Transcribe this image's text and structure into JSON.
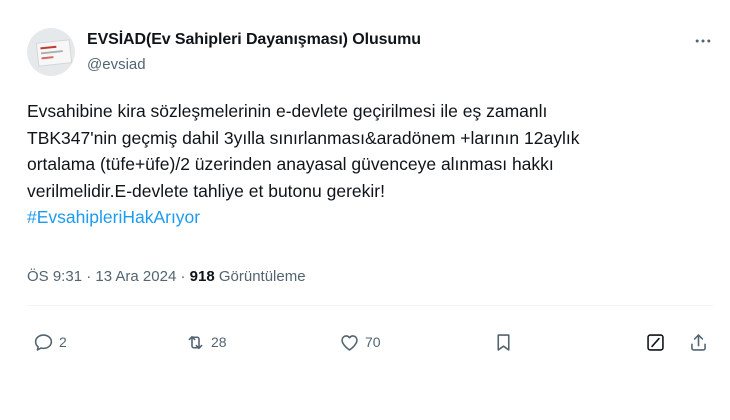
{
  "author": {
    "display_name": "EVSİAD(Ev Sahipleri Dayanışması) Olusumu",
    "handle": "@evsiad"
  },
  "more_icon": "more-horizontal-icon",
  "tweet": {
    "lines": [
      "Evsahibine kira sözleşmelerinin e-devlete geçirilmesi ile eş zamanlı",
      "TBK347'nin geçmiş dahil 3yılla sınırlanması&aradönem +larının 12aylık",
      "ortalama (tüfe+üfe)/2 üzerinden anayasal güvenceye alınması hakkı",
      "verilmelidir.E-devlete tahliye et butonu gerekir!"
    ],
    "hashtag": "#EvsahipleriHakArıyor"
  },
  "meta": {
    "time": "ÖS 9:31",
    "separator1": "·",
    "date": "13 Ara 2024",
    "separator2": "·",
    "views_count": "918",
    "views_label": "Görüntüleme"
  },
  "actions": {
    "replies": "2",
    "retweets": "28",
    "likes": "70"
  },
  "colors": {
    "link": "#1d9bf0",
    "secondary_text": "#536471",
    "primary_text": "#0f1419"
  }
}
